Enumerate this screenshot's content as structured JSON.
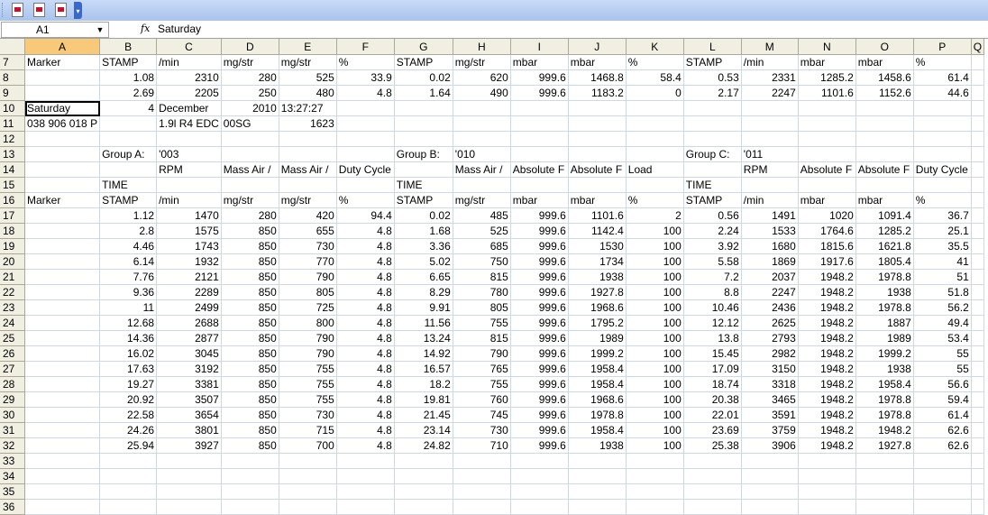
{
  "toolbar": {
    "icons": [
      "pdf-icon",
      "pdf-icon",
      "pdf-email-icon"
    ]
  },
  "formula_bar": {
    "name_box": "A1",
    "fx_label": "fx",
    "value": "Saturday"
  },
  "columns": [
    "A",
    "B",
    "C",
    "D",
    "E",
    "F",
    "G",
    "H",
    "I",
    "J",
    "K",
    "L",
    "M",
    "N",
    "O",
    "P",
    "Q"
  ],
  "rows": [
    {
      "n": "7",
      "c": [
        "Marker",
        "STAMP",
        "/min",
        "mg/str",
        "mg/str",
        "%",
        "STAMP",
        "mg/str",
        "mbar",
        "mbar",
        "%",
        "STAMP",
        "/min",
        "mbar",
        "mbar",
        "%",
        ""
      ]
    },
    {
      "n": "8",
      "c": [
        "",
        "1.08",
        "2310",
        "280",
        "525",
        "33.9",
        "0.02",
        "620",
        "999.6",
        "1468.8",
        "58.4",
        "0.53",
        "2331",
        "1285.2",
        "1458.6",
        "61.4",
        ""
      ]
    },
    {
      "n": "9",
      "c": [
        "",
        "2.69",
        "2205",
        "250",
        "480",
        "4.8",
        "1.64",
        "490",
        "999.6",
        "1183.2",
        "0",
        "2.17",
        "2247",
        "1101.6",
        "1152.6",
        "44.6",
        ""
      ]
    },
    {
      "n": "10",
      "c": [
        "Saturday",
        "4",
        "December",
        "2010",
        "13:27:27",
        "",
        "",
        "",
        "",
        "",
        "",
        "",
        "",
        "",
        "",
        "",
        ""
      ]
    },
    {
      "n": "11",
      "c": [
        "038 906 018 P",
        "",
        "1.9l R4 EDC",
        "00SG",
        "1623",
        "",
        "",
        "",
        "",
        "",
        "",
        "",
        "",
        "",
        "",
        "",
        ""
      ]
    },
    {
      "n": "12",
      "c": [
        "",
        "",
        "",
        "",
        "",
        "",
        "",
        "",
        "",
        "",
        "",
        "",
        "",
        "",
        "",
        "",
        ""
      ]
    },
    {
      "n": "13",
      "c": [
        "",
        "Group A:",
        "'003",
        "",
        "",
        "",
        "Group B:",
        "'010",
        "",
        "",
        "",
        "Group C:",
        "'011",
        "",
        "",
        "",
        ""
      ]
    },
    {
      "n": "14",
      "c": [
        "",
        "",
        "RPM",
        "Mass Air /",
        "Mass Air /",
        "Duty Cycle",
        "",
        "Mass Air /",
        "Absolute F",
        "Absolute F",
        "Load",
        "",
        "RPM",
        "Absolute F",
        "Absolute F",
        "Duty Cycle",
        ""
      ]
    },
    {
      "n": "15",
      "c": [
        "",
        "TIME",
        "",
        "",
        "",
        "",
        "TIME",
        "",
        "",
        "",
        "",
        "TIME",
        "",
        "",
        "",
        "",
        ""
      ]
    },
    {
      "n": "16",
      "c": [
        "Marker",
        "STAMP",
        "/min",
        "mg/str",
        "mg/str",
        "%",
        "STAMP",
        "mg/str",
        "mbar",
        "mbar",
        "%",
        "STAMP",
        "/min",
        "mbar",
        "mbar",
        "%",
        ""
      ]
    },
    {
      "n": "17",
      "c": [
        "",
        "1.12",
        "1470",
        "280",
        "420",
        "94.4",
        "0.02",
        "485",
        "999.6",
        "1101.6",
        "2",
        "0.56",
        "1491",
        "1020",
        "1091.4",
        "36.7",
        ""
      ]
    },
    {
      "n": "18",
      "c": [
        "",
        "2.8",
        "1575",
        "850",
        "655",
        "4.8",
        "1.68",
        "525",
        "999.6",
        "1142.4",
        "100",
        "2.24",
        "1533",
        "1764.6",
        "1285.2",
        "25.1",
        ""
      ]
    },
    {
      "n": "19",
      "c": [
        "",
        "4.46",
        "1743",
        "850",
        "730",
        "4.8",
        "3.36",
        "685",
        "999.6",
        "1530",
        "100",
        "3.92",
        "1680",
        "1815.6",
        "1621.8",
        "35.5",
        ""
      ]
    },
    {
      "n": "20",
      "c": [
        "",
        "6.14",
        "1932",
        "850",
        "770",
        "4.8",
        "5.02",
        "750",
        "999.6",
        "1734",
        "100",
        "5.58",
        "1869",
        "1917.6",
        "1805.4",
        "41",
        ""
      ]
    },
    {
      "n": "21",
      "c": [
        "",
        "7.76",
        "2121",
        "850",
        "790",
        "4.8",
        "6.65",
        "815",
        "999.6",
        "1938",
        "100",
        "7.2",
        "2037",
        "1948.2",
        "1978.8",
        "51",
        ""
      ]
    },
    {
      "n": "22",
      "c": [
        "",
        "9.36",
        "2289",
        "850",
        "805",
        "4.8",
        "8.29",
        "780",
        "999.6",
        "1927.8",
        "100",
        "8.8",
        "2247",
        "1948.2",
        "1938",
        "51.8",
        ""
      ]
    },
    {
      "n": "23",
      "c": [
        "",
        "11",
        "2499",
        "850",
        "725",
        "4.8",
        "9.91",
        "805",
        "999.6",
        "1968.6",
        "100",
        "10.46",
        "2436",
        "1948.2",
        "1978.8",
        "56.2",
        ""
      ]
    },
    {
      "n": "24",
      "c": [
        "",
        "12.68",
        "2688",
        "850",
        "800",
        "4.8",
        "11.56",
        "755",
        "999.6",
        "1795.2",
        "100",
        "12.12",
        "2625",
        "1948.2",
        "1887",
        "49.4",
        ""
      ]
    },
    {
      "n": "25",
      "c": [
        "",
        "14.36",
        "2877",
        "850",
        "790",
        "4.8",
        "13.24",
        "815",
        "999.6",
        "1989",
        "100",
        "13.8",
        "2793",
        "1948.2",
        "1989",
        "53.4",
        ""
      ]
    },
    {
      "n": "26",
      "c": [
        "",
        "16.02",
        "3045",
        "850",
        "790",
        "4.8",
        "14.92",
        "790",
        "999.6",
        "1999.2",
        "100",
        "15.45",
        "2982",
        "1948.2",
        "1999.2",
        "55",
        ""
      ]
    },
    {
      "n": "27",
      "c": [
        "",
        "17.63",
        "3192",
        "850",
        "755",
        "4.8",
        "16.57",
        "765",
        "999.6",
        "1958.4",
        "100",
        "17.09",
        "3150",
        "1948.2",
        "1938",
        "55",
        ""
      ]
    },
    {
      "n": "28",
      "c": [
        "",
        "19.27",
        "3381",
        "850",
        "755",
        "4.8",
        "18.2",
        "755",
        "999.6",
        "1958.4",
        "100",
        "18.74",
        "3318",
        "1948.2",
        "1958.4",
        "56.6",
        ""
      ]
    },
    {
      "n": "29",
      "c": [
        "",
        "20.92",
        "3507",
        "850",
        "755",
        "4.8",
        "19.81",
        "760",
        "999.6",
        "1968.6",
        "100",
        "20.38",
        "3465",
        "1948.2",
        "1978.8",
        "59.4",
        ""
      ]
    },
    {
      "n": "30",
      "c": [
        "",
        "22.58",
        "3654",
        "850",
        "730",
        "4.8",
        "21.45",
        "745",
        "999.6",
        "1978.8",
        "100",
        "22.01",
        "3591",
        "1948.2",
        "1978.8",
        "61.4",
        ""
      ]
    },
    {
      "n": "31",
      "c": [
        "",
        "24.26",
        "3801",
        "850",
        "715",
        "4.8",
        "23.14",
        "730",
        "999.6",
        "1958.4",
        "100",
        "23.69",
        "3759",
        "1948.2",
        "1948.2",
        "62.6",
        ""
      ]
    },
    {
      "n": "32",
      "c": [
        "",
        "25.94",
        "3927",
        "850",
        "700",
        "4.8",
        "24.82",
        "710",
        "999.6",
        "1938",
        "100",
        "25.38",
        "3906",
        "1948.2",
        "1927.8",
        "62.6",
        ""
      ]
    },
    {
      "n": "33",
      "c": [
        "",
        "",
        "",
        "",
        "",
        "",
        "",
        "",
        "",
        "",
        "",
        "",
        "",
        "",
        "",
        "",
        ""
      ]
    },
    {
      "n": "34",
      "c": [
        "",
        "",
        "",
        "",
        "",
        "",
        "",
        "",
        "",
        "",
        "",
        "",
        "",
        "",
        "",
        "",
        ""
      ]
    },
    {
      "n": "35",
      "c": [
        "",
        "",
        "",
        "",
        "",
        "",
        "",
        "",
        "",
        "",
        "",
        "",
        "",
        "",
        "",
        "",
        ""
      ]
    },
    {
      "n": "36",
      "c": [
        "",
        "",
        "",
        "",
        "",
        "",
        "",
        "",
        "",
        "",
        "",
        "",
        "",
        "",
        "",
        "",
        ""
      ]
    }
  ],
  "selected_cell": {
    "row": "10",
    "col": "A"
  }
}
